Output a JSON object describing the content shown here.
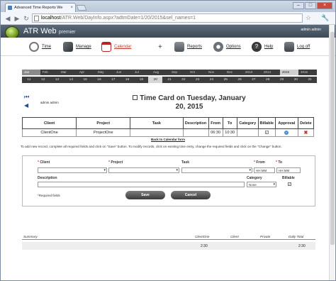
{
  "browser": {
    "tab_title": "Advanced Time Reports We",
    "url_host": "localhost",
    "url_rest": "/ATR.Web/DayInfo.aspx?adtmDate=1/20/2015&sel_names=1"
  },
  "app": {
    "brand": "ATR Web",
    "brand_suffix": "premier",
    "user": "admin admin"
  },
  "toolbar": {
    "time": "Time",
    "manage": "Manage",
    "calendar": "Calendar",
    "plus": "+",
    "reports": "Reports",
    "options": "Options",
    "help": "Help",
    "logoff": "Log off"
  },
  "months": [
    "Jan",
    "Feb",
    "Mar",
    "Apr",
    "May",
    "Jun",
    "Jul",
    "Aug",
    "Sep",
    "Oct",
    "Nov",
    "Dec"
  ],
  "years": [
    "2013",
    "2014",
    "2015",
    "2016"
  ],
  "days": [
    "11",
    "12",
    "13",
    "14",
    "15",
    "16",
    "17",
    "18",
    "19",
    "20",
    "21",
    "22",
    "23",
    "24",
    "25",
    "26",
    "27",
    "28",
    "29",
    "30",
    "31"
  ],
  "page": {
    "user": "admin admin",
    "title": "Time Card on Tuesday, January 20, 2015"
  },
  "table": {
    "headers": [
      "Client",
      "Project",
      "Task",
      "Description",
      "From",
      "To",
      "Category",
      "Billable",
      "Approval",
      "Delete"
    ],
    "row": {
      "client": "ClientOne",
      "project": "ProjectOne",
      "task": "",
      "description": "",
      "from": "06:30",
      "to": "10:30",
      "category": "",
      "billable": "✓",
      "approval": "✓",
      "delete": "✖"
    }
  },
  "back_link": "Back to Calendar form",
  "info_text": "To add new record, complete all required fields and click on \"Save\" button. To modify records, click on existing time entry, change the required fields and click on the \"Change\" button.",
  "form": {
    "client_label": "Client",
    "project_label": "Project",
    "task_label": "Task",
    "from_label": "From",
    "to_label": "To",
    "description_label": "Description",
    "category_label": "Category",
    "billable_label": "Billable",
    "from_placeholder": "HH:MM",
    "to_placeholder": "HH:MM",
    "category_value": "None",
    "billable_check": "✓",
    "required_note": "Required fields",
    "save": "Save",
    "cancel": "Cancel"
  },
  "summary": {
    "label": "Summary",
    "col1": "ClientOne",
    "col2": "Client",
    "col3": "Private",
    "col4": "Daily Total",
    "val1": "2:30",
    "val4": "2:30"
  }
}
